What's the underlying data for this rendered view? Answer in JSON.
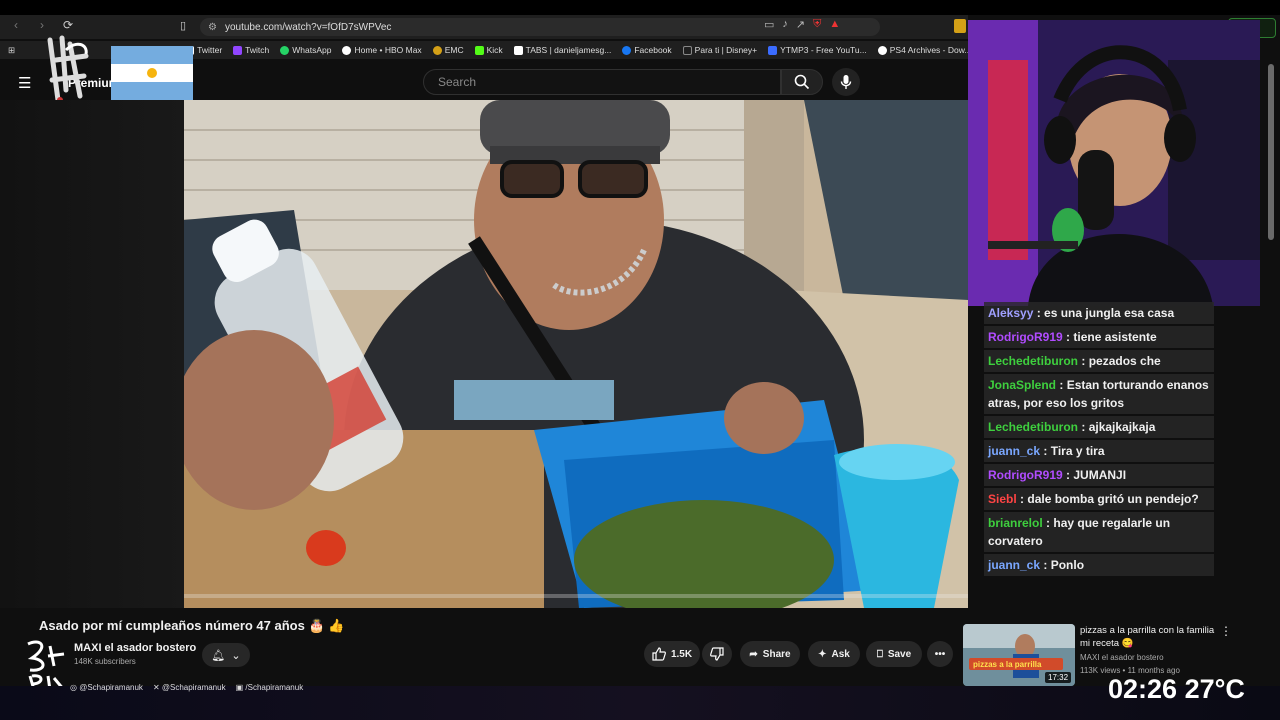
{
  "browser": {
    "url": "youtube.com/watch?v=fOfD7sWPVec",
    "bookmarks": [
      {
        "label": "Twitter",
        "color": "#ffffff"
      },
      {
        "label": "Twitch",
        "color": "#9146ff"
      },
      {
        "label": "WhatsApp",
        "color": "#25d366"
      },
      {
        "label": "Home • HBO Max",
        "color": "#ffffff"
      },
      {
        "label": "EMC",
        "color": "#d4a017"
      },
      {
        "label": "Kick",
        "color": "#53fc18"
      },
      {
        "label": "TABS | danieljamesg...",
        "color": "#ffffff"
      },
      {
        "label": "Facebook",
        "color": "#1877f2"
      },
      {
        "label": "Para ti | Disney+",
        "color": "#ffffff"
      },
      {
        "label": "YTMP3 - Free YouTu...",
        "color": "#3b6cff"
      },
      {
        "label": "PS4 Archives - Dow...",
        "color": "#ffffff"
      }
    ]
  },
  "youtube": {
    "premium_label": "Premium",
    "search_placeholder": "Search"
  },
  "chat": [
    {
      "user": "Aleksyy",
      "color": "#a0a0ff",
      "text": "es una jungla esa casa"
    },
    {
      "user": "RodrigoR919",
      "color": "#b14cff",
      "text": "tiene asistente"
    },
    {
      "user": "Lechedetiburon",
      "color": "#3ecf3e",
      "text": "pezados che"
    },
    {
      "user": "JonaSplend",
      "color": "#3ecf3e",
      "text": "Estan torturando enanos atras, por eso los gritos"
    },
    {
      "user": "Lechedetiburon",
      "color": "#3ecf3e",
      "text": "ajkajkajkaja"
    },
    {
      "user": "juann_ck",
      "color": "#7aa7ff",
      "text": "Tira y tira"
    },
    {
      "user": "RodrigoR919",
      "color": "#b14cff",
      "text": "JUMANJI"
    },
    {
      "user": "Siebl",
      "color": "#ff4444",
      "text": "dale bomba gritó un pendejo?"
    },
    {
      "user": "brianrelol",
      "color": "#3ecf3e",
      "text": "hay que regalarle un corvatero"
    },
    {
      "user": "juann_ck",
      "color": "#7aa7ff",
      "text": "Ponlo"
    }
  ],
  "video": {
    "title": "Asado por mí cumpleaños número 47 años 🎂 👍",
    "channel": "MAXI el asador bostero",
    "subscribers": "148K subscribers",
    "likes": "1.5K",
    "share_label": "Share",
    "ask_label": "Ask",
    "save_label": "Save"
  },
  "recommended": {
    "title": "pizzas a la parrilla con la familia mi receta 😋",
    "channel": "MAXI el asador bostero",
    "meta": "113K views • 11 months ago",
    "duration": "17:32",
    "thumb_text": "pizzas a la parrilla"
  },
  "overlay": {
    "socials": [
      "@Schapiramanuk",
      "@Schapiramanuk",
      "/Schapiramanuk"
    ],
    "clock": "02:26",
    "temperature": "27°C"
  }
}
